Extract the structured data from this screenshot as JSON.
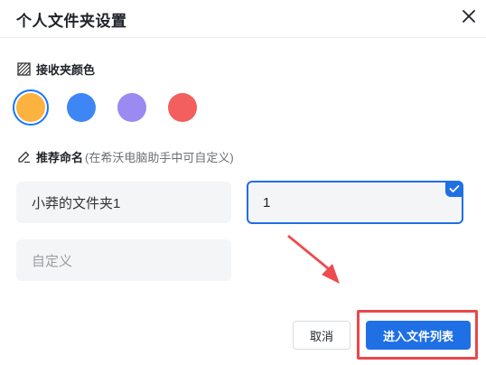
{
  "dialog": {
    "title": "个人文件夹设置",
    "close_icon": "close-icon"
  },
  "color_section": {
    "label": "接收夹颜色",
    "icon": "hatched-square-icon",
    "swatches": [
      {
        "name": "orange",
        "color": "#FBB23F",
        "selected": true
      },
      {
        "name": "blue",
        "color": "#3E86F5",
        "selected": false
      },
      {
        "name": "purple",
        "color": "#9A8AF2",
        "selected": false
      },
      {
        "name": "red",
        "color": "#F35E5E",
        "selected": false
      }
    ],
    "selected_ring_color": "#1677FF"
  },
  "naming_section": {
    "label": "推荐命名",
    "hint": "(在希沃电脑助手中可自定义)",
    "icon": "pencil-icon",
    "options": [
      {
        "text": "小莽的文件夹1",
        "selected": false
      },
      {
        "text": "1",
        "selected": true
      },
      {
        "text": "自定义",
        "placeholder": true,
        "selected": false
      }
    ]
  },
  "footer": {
    "cancel_label": "取消",
    "confirm_label": "进入文件列表"
  },
  "colors": {
    "accent": "#1F6FE5",
    "annotation_red": "#E9474B"
  }
}
